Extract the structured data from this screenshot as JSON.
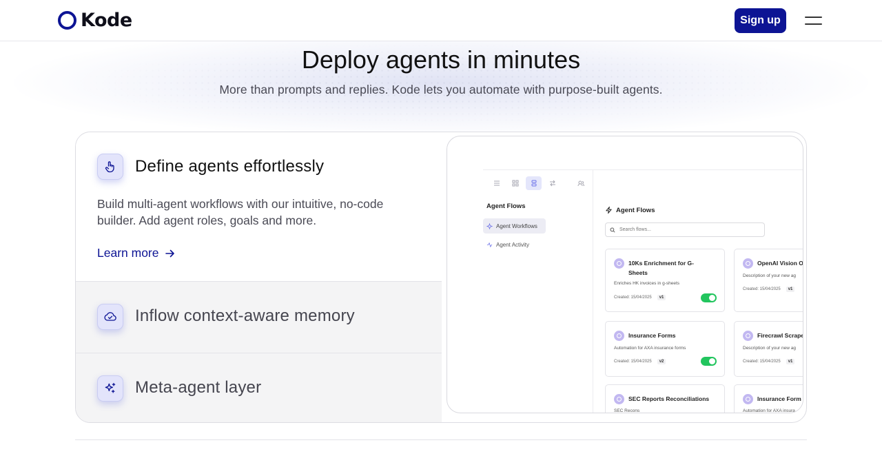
{
  "header": {
    "logo_text": "Kode",
    "signup_label": "Sign up",
    "menu_icon": "hamburger-menu-icon"
  },
  "hero": {
    "title": "Deploy agents in minutes",
    "subtitle": "More than prompts and replies. Kode lets you automate with purpose-built agents."
  },
  "features": [
    {
      "icon": "pointer-hand-icon",
      "title": "Define agents effortlessly",
      "description": "Build multi-agent workflows with our intuitive, no-code builder. Add agent roles, goals and more.",
      "link_label": "Learn more",
      "active": true
    },
    {
      "icon": "cloud-check-icon",
      "title": "Inflow context-aware memory",
      "active": false
    },
    {
      "icon": "sparkles-icon",
      "title": "Meta-agent layer",
      "active": false
    }
  ],
  "preview": {
    "sidebar": {
      "heading": "Agent Flows",
      "items": [
        {
          "label": "Agent Workflows",
          "icon": "sparkle-icon",
          "active": true
        },
        {
          "label": "Agent Activity",
          "icon": "activity-icon",
          "active": false
        }
      ]
    },
    "main_heading": "Agent Flows",
    "search_placeholder": "Search flows...",
    "cards": [
      {
        "name": "10Ks Enrichment for G-Sheets",
        "description": "Enriches HK invoices in g-sheets",
        "created": "Created: 15/04/2025",
        "version": "v1",
        "enabled": true
      },
      {
        "name": "OpenAI Vision O",
        "description": "Description of your new ag",
        "created": "Created: 15/04/2025",
        "version": "v1"
      },
      {
        "name": "Insurance Forms",
        "description": "Automation for AXA insurance forms",
        "created": "Created: 15/04/2025",
        "version": "v2",
        "enabled": true
      },
      {
        "name": "Firecrawl Scrape",
        "description": "Description of your new ag",
        "created": "Created: 15/04/2025",
        "version": "v1"
      },
      {
        "name": "SEC Reports Reconciliations",
        "description": "SEC Recons"
      },
      {
        "name": "Insurance Form",
        "description": "Automation for AXA insura"
      }
    ],
    "accent_color": "#0d1494",
    "toggle_color": "#22c55e"
  }
}
